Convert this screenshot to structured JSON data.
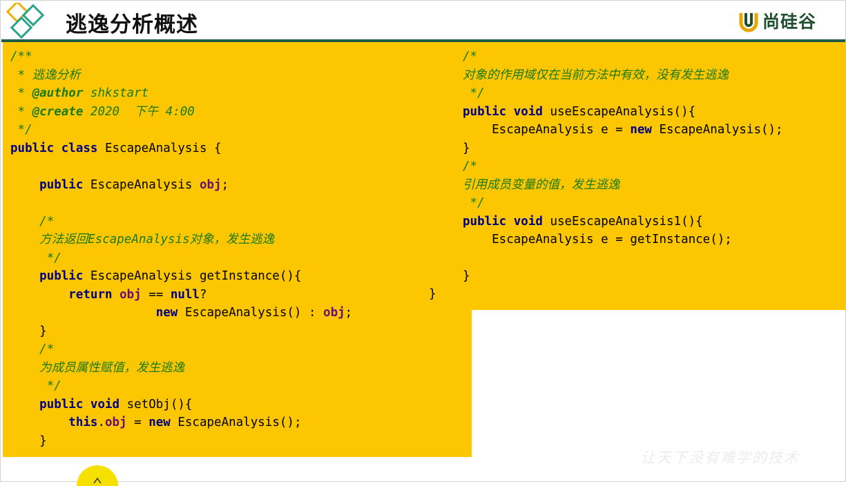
{
  "header": {
    "title": "逃逸分析概述",
    "brand": "尚硅谷"
  },
  "code_left": [
    [
      [
        "cm",
        "/**"
      ]
    ],
    [
      [
        "cm",
        " * 逃逸分析"
      ]
    ],
    [
      [
        "cm",
        " * "
      ],
      [
        "tag",
        "@author"
      ],
      [
        "cm",
        " shkstart"
      ]
    ],
    [
      [
        "cm",
        " * "
      ],
      [
        "tag",
        "@create"
      ],
      [
        "cm",
        " 2020  下午 4:00"
      ]
    ],
    [
      [
        "cm",
        " */"
      ]
    ],
    [
      [
        "kw",
        "public class"
      ],
      [
        "t",
        " EscapeAnalysis {"
      ]
    ],
    [],
    [
      [
        "t",
        "    "
      ],
      [
        "kw",
        "public"
      ],
      [
        "t",
        " EscapeAnalysis "
      ],
      [
        "fld",
        "obj"
      ],
      [
        "t",
        ";"
      ]
    ],
    [],
    [
      [
        "t",
        "    "
      ],
      [
        "cm",
        "/*"
      ]
    ],
    [
      [
        "t",
        "    "
      ],
      [
        "cm",
        "方法返回EscapeAnalysis对象，发生逃逸"
      ]
    ],
    [
      [
        "t",
        "     "
      ],
      [
        "cm",
        "*/"
      ]
    ],
    [
      [
        "t",
        "    "
      ],
      [
        "kw",
        "public"
      ],
      [
        "t",
        " EscapeAnalysis getInstance(){"
      ]
    ],
    [
      [
        "t",
        "        "
      ],
      [
        "kw",
        "return"
      ],
      [
        "t",
        " "
      ],
      [
        "fld",
        "obj"
      ],
      [
        "t",
        " == "
      ],
      [
        "kw",
        "null"
      ],
      [
        "t",
        "?"
      ]
    ],
    [
      [
        "t",
        "                    "
      ],
      [
        "kw",
        "new"
      ],
      [
        "t",
        " EscapeAnalysis() : "
      ],
      [
        "fld",
        "obj"
      ],
      [
        "t",
        ";"
      ]
    ],
    [
      [
        "t",
        "    }"
      ]
    ],
    [
      [
        "t",
        "    "
      ],
      [
        "cm",
        "/*"
      ]
    ],
    [
      [
        "t",
        "    "
      ],
      [
        "cm",
        "为成员属性赋值，发生逃逸"
      ]
    ],
    [
      [
        "t",
        "     "
      ],
      [
        "cm",
        "*/"
      ]
    ],
    [
      [
        "t",
        "    "
      ],
      [
        "kw",
        "public void"
      ],
      [
        "t",
        " setObj(){"
      ]
    ],
    [
      [
        "t",
        "        "
      ],
      [
        "kw",
        "this"
      ],
      [
        "t",
        "."
      ],
      [
        "fld",
        "obj"
      ],
      [
        "t",
        " = "
      ],
      [
        "kw",
        "new"
      ],
      [
        "t",
        " EscapeAnalysis();"
      ]
    ],
    [
      [
        "t",
        "    }"
      ]
    ]
  ],
  "code_right": [
    [
      [
        "cm",
        "/*"
      ]
    ],
    [
      [
        "cm",
        "对象的作用域仅在当前方法中有效，没有发生逃逸"
      ]
    ],
    [
      [
        "cm",
        " */"
      ]
    ],
    [
      [
        "kw",
        "public void"
      ],
      [
        "t",
        " useEscapeAnalysis(){"
      ]
    ],
    [
      [
        "t",
        "    EscapeAnalysis e = "
      ],
      [
        "kw",
        "new"
      ],
      [
        "t",
        " EscapeAnalysis();"
      ]
    ],
    [
      [
        "t",
        "}"
      ]
    ],
    [
      [
        "cm",
        "/*"
      ]
    ],
    [
      [
        "cm",
        "引用成员变量的值，发生逃逸"
      ]
    ],
    [
      [
        "cm",
        " */"
      ]
    ],
    [
      [
        "kw",
        "public void"
      ],
      [
        "t",
        " useEscapeAnalysis1(){"
      ]
    ],
    [
      [
        "t",
        "    EscapeAnalysis e = getInstance();"
      ]
    ],
    [],
    [
      [
        "t",
        "}"
      ]
    ]
  ],
  "stray_brace": "}",
  "watermark": "让天下没有难学的技术",
  "colors": {
    "panel": "#fcc600",
    "comment": "#1a7a1a",
    "keyword": "#000080",
    "field": "#660e7a",
    "divider": "#1e5a4a"
  }
}
